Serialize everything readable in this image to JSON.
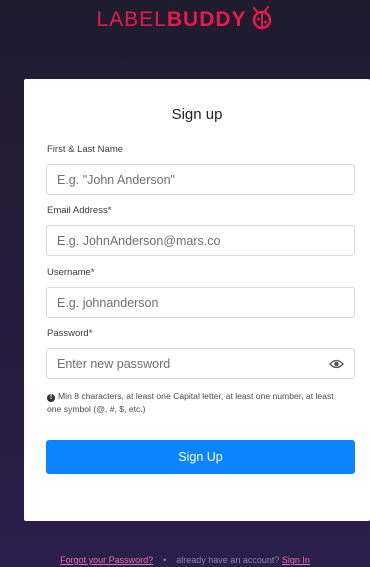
{
  "brand": {
    "light": "LABEL",
    "bold": "BUDDY"
  },
  "form": {
    "title": "Sign up",
    "fields": [
      {
        "label": "First & Last Name",
        "placeholder": "E.g. \"John Anderson\""
      },
      {
        "label": "Email Address*",
        "placeholder": "E.g. JohnAnderson@mars.co"
      },
      {
        "label": "Username*",
        "placeholder": "E.g. johnanderson"
      },
      {
        "label": "Password*",
        "placeholder": "Enter new password"
      }
    ],
    "password_hint": "Min 8 characters, at least one Capital letter, at least one number, at least one symbol (@, #, $, etc.)",
    "submit_label": "Sign Up"
  },
  "footer": {
    "forgot": "Forgot your Password?",
    "separator": "•",
    "have_account": "already have an account?",
    "sign_in": "Sign In"
  },
  "colors": {
    "brand": "#e8194f",
    "button": "#0a84ff",
    "link": "#f06ea9"
  }
}
